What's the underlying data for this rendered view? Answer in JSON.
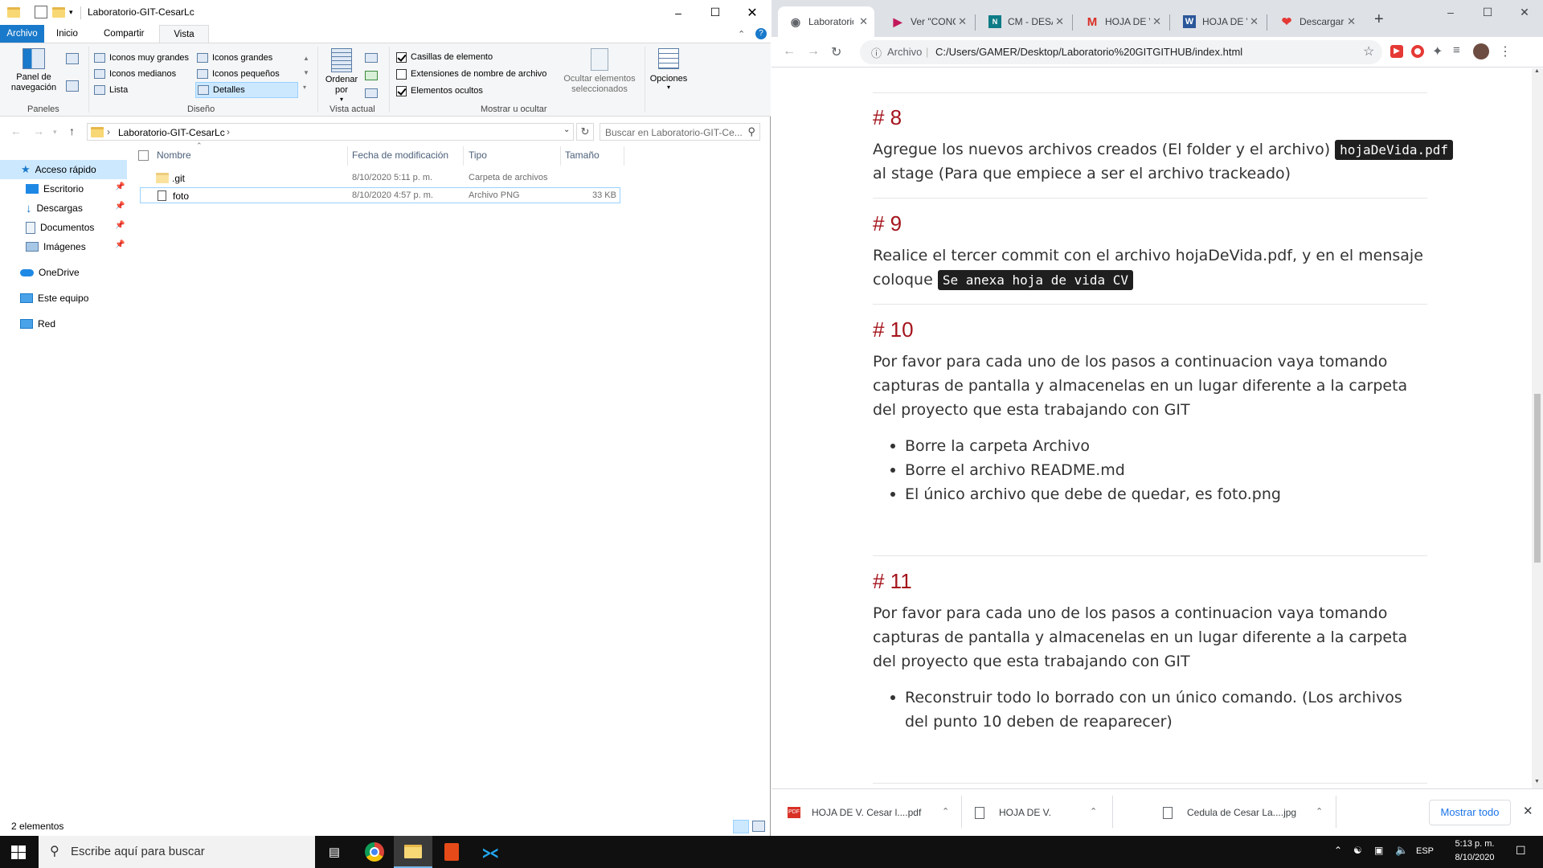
{
  "explorer": {
    "window_title": "Laboratorio-GIT-CesarLc",
    "ribbon_tabs": [
      "Archivo",
      "Inicio",
      "Compartir",
      "Vista"
    ],
    "panes_group": {
      "nav_pane": "Panel de navegación",
      "label": "Paneles"
    },
    "layout_group": {
      "label": "Diseño",
      "items": [
        "Iconos muy grandes",
        "Iconos grandes",
        "Iconos medianos",
        "Iconos pequeños",
        "Lista",
        "Detalles"
      ],
      "selected": "Detalles"
    },
    "current_view_group": {
      "sort_by": "Ordenar por",
      "label": "Vista actual"
    },
    "show_hide_group": {
      "label": "Mostrar u ocultar",
      "checkboxes": [
        {
          "label": "Casillas de elemento",
          "checked": true
        },
        {
          "label": "Extensiones de nombre de archivo",
          "checked": false
        },
        {
          "label": "Elementos ocultos",
          "checked": true
        }
      ],
      "hide_selected": "Ocultar elementos seleccionados"
    },
    "options_label": "Opciones",
    "breadcrumb": "Laboratorio-GIT-CesarLc",
    "search_placeholder": "Buscar en Laboratorio-GIT-Ce...",
    "nav_items": [
      {
        "label": "Acceso rápido",
        "icon": "star-icon"
      },
      {
        "label": "Escritorio",
        "icon": "desktop-icon"
      },
      {
        "label": "Descargas",
        "icon": "download-icon"
      },
      {
        "label": "Documentos",
        "icon": "documents-icon"
      },
      {
        "label": "Imágenes",
        "icon": "pictures-icon"
      },
      {
        "label": "OneDrive",
        "icon": "onedrive-icon"
      },
      {
        "label": "Este equipo",
        "icon": "pc-icon"
      },
      {
        "label": "Red",
        "icon": "network-icon"
      }
    ],
    "columns": [
      "Nombre",
      "Fecha de modificación",
      "Tipo",
      "Tamaño"
    ],
    "files": [
      {
        "name": ".git",
        "date": "8/10/2020 5:11 p. m.",
        "type": "Carpeta de archivos",
        "size": ""
      },
      {
        "name": "foto",
        "date": "8/10/2020 4:57 p. m.",
        "type": "Archivo PNG",
        "size": "33 KB"
      }
    ],
    "status": "2 elementos"
  },
  "browser": {
    "tabs": [
      {
        "title": "Laboratorio",
        "icon": "globe-icon",
        "active": true
      },
      {
        "title": "Ver \"CONC",
        "icon": "play-icon",
        "color": "#c2185b"
      },
      {
        "title": "CM - DESA",
        "icon": "n-icon",
        "color": "#0e7c86"
      },
      {
        "title": "HOJA DE V",
        "icon": "gmail-icon",
        "color": "#d93025"
      },
      {
        "title": "HOJA DE V",
        "icon": "word-icon",
        "color": "#2b579a"
      },
      {
        "title": "Descargar",
        "icon": "heart-icon",
        "color": "#e53935"
      }
    ],
    "address_prefix": "Archivo",
    "url": "C:/Users/GAMER/Desktop/Laboratorio%20GITGITHUB/index.html",
    "sections": [
      {
        "heading": "# 8",
        "text_before": "Agregue los nuevos archivos creados (El folder y el archivo)",
        "code": "hojaDeVida.pdf",
        "text_after": "al stage (Para que empiece a ser el archivo trackeado)"
      },
      {
        "heading": "# 9",
        "text_before": "Realice el tercer commit con el archivo hojaDeVida.pdf, y en el mensaje coloque",
        "code": "Se anexa hoja de vida CV"
      },
      {
        "heading": "# 10",
        "text": "Por favor para cada uno de los pasos a continuacion vaya tomando capturas de pantalla y almacenelas en un lugar diferente a la carpeta del proyecto que esta trabajando con GIT",
        "bullets": [
          "Borre la carpeta Archivo",
          "Borre el archivo README.md",
          "El único archivo que debe de quedar, es foto.png"
        ]
      },
      {
        "heading": "# 11",
        "text": "Por favor para cada uno de los pasos a continuacion vaya tomando capturas de pantalla y almacenelas en un lugar diferente a la carpeta del proyecto que esta trabajando con GIT",
        "bullets": [
          "Reconstruir todo lo borrado con un único comando. (Los archivos del punto 10 deben de reaparecer)"
        ]
      }
    ],
    "downloads": [
      {
        "name": "HOJA DE V. Cesar l....pdf",
        "icon": "pdf-icon"
      },
      {
        "name": "HOJA DE V.",
        "icon": "file-icon"
      },
      {
        "name": "Cedula de Cesar La....jpg",
        "icon": "image-file-icon"
      }
    ],
    "show_all": "Mostrar todo"
  },
  "taskbar": {
    "search_placeholder": "Escribe aquí para buscar",
    "lang": "ESP",
    "time": "5:13 p. m.",
    "date": "8/10/2020"
  }
}
